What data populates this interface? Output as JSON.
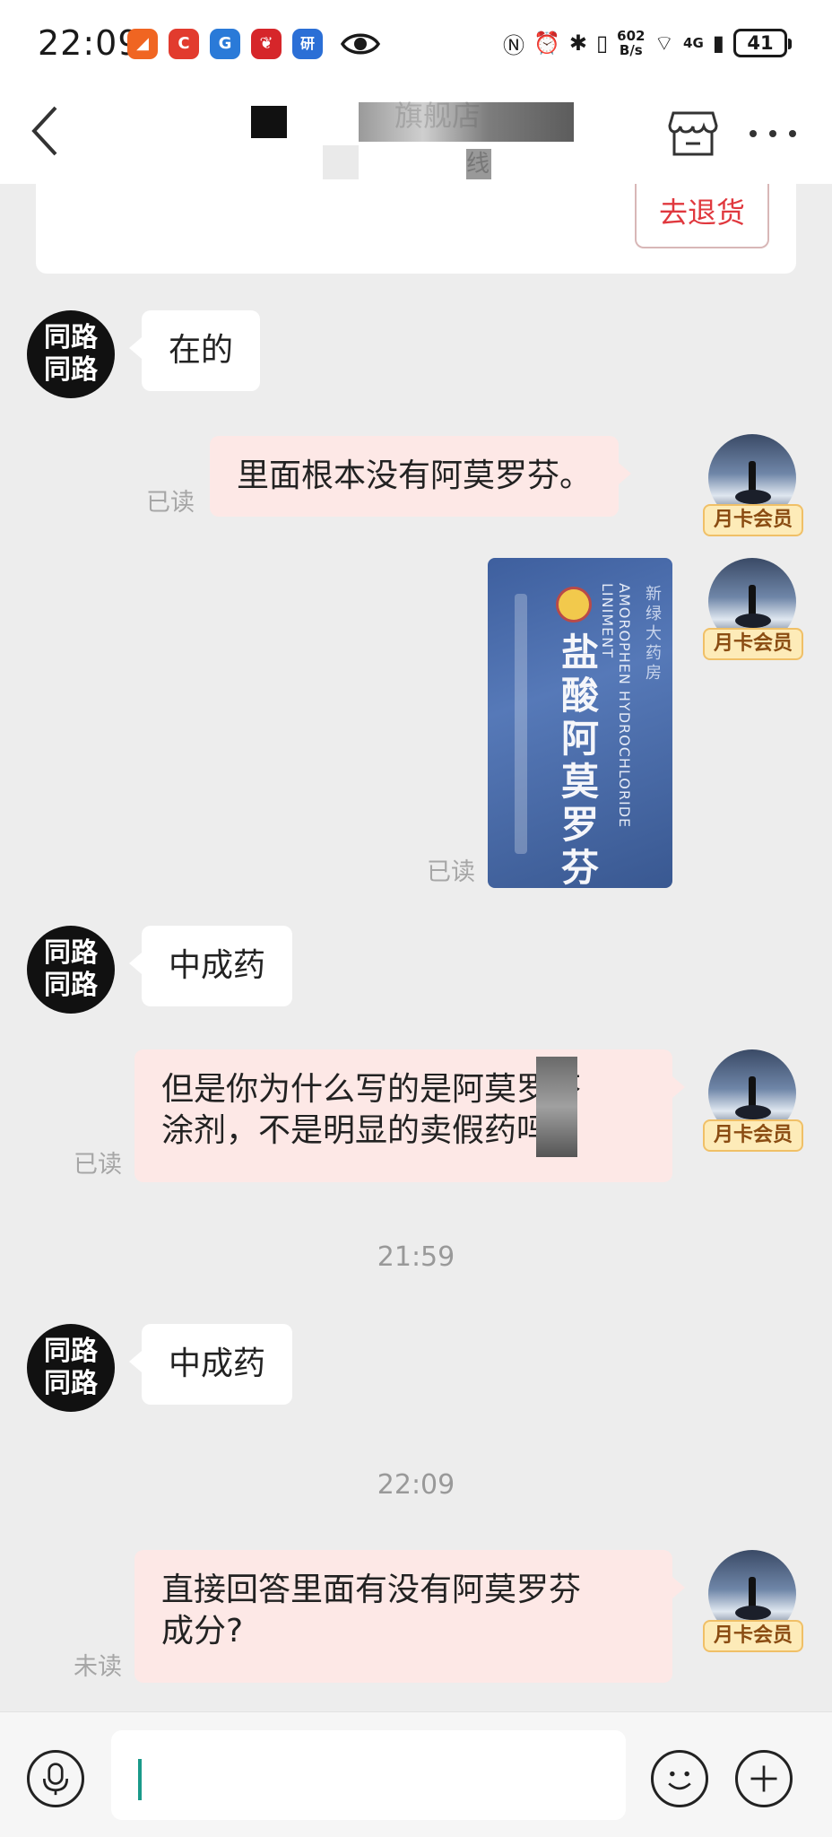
{
  "status_bar": {
    "time": "22:09",
    "apps": [
      {
        "icon": "flyme-app-icon",
        "glyph": "◢",
        "color": "#f06522"
      },
      {
        "icon": "c-app-icon",
        "glyph": "C",
        "color": "#e23b2e"
      },
      {
        "icon": "g-app-icon",
        "glyph": "G",
        "color": "#2a7ad8"
      },
      {
        "icon": "store-app-icon",
        "glyph": "❦",
        "color": "#d6262a"
      },
      {
        "icon": "yan-app-icon",
        "glyph": "研",
        "color": "#2b6fd6"
      }
    ],
    "net_speed_value": "602",
    "net_speed_unit": "B/s",
    "signal_label": "4G",
    "battery": "41"
  },
  "header": {
    "title_partial": "旗舰店",
    "subtitle_partial": "线"
  },
  "order_card": {
    "return_button_label": "去退货"
  },
  "bot_avatar_text": "同路同路",
  "vip_badge": "月卡会员",
  "messages": {
    "m1": "在的",
    "m2": "里面根本没有阿莫罗芬。",
    "m2_status": "已读",
    "m3_status": "已读",
    "m4": "中成药",
    "m5_line1": "但是你为什么写的是阿莫罗芬",
    "m5_line2": "涂剂，不是明显的卖假药吗?",
    "m5_status": "已读",
    "t1": "21:59",
    "m6": "中成药",
    "t2": "22:09",
    "m7_line1": "直接回答里面有没有阿莫罗芬",
    "m7_line2": "成分?",
    "m7_status": "未读"
  },
  "photo": {
    "title": "盐酸阿莫罗芬",
    "english": "AMOROPHEN HYDROCHLORIDE LINIMENT",
    "brand": "新绿大药房"
  },
  "colors": {
    "accent_red": "#e0383e",
    "bubble_right": "#fde8e6",
    "vip_gold": "#fdebb8"
  }
}
